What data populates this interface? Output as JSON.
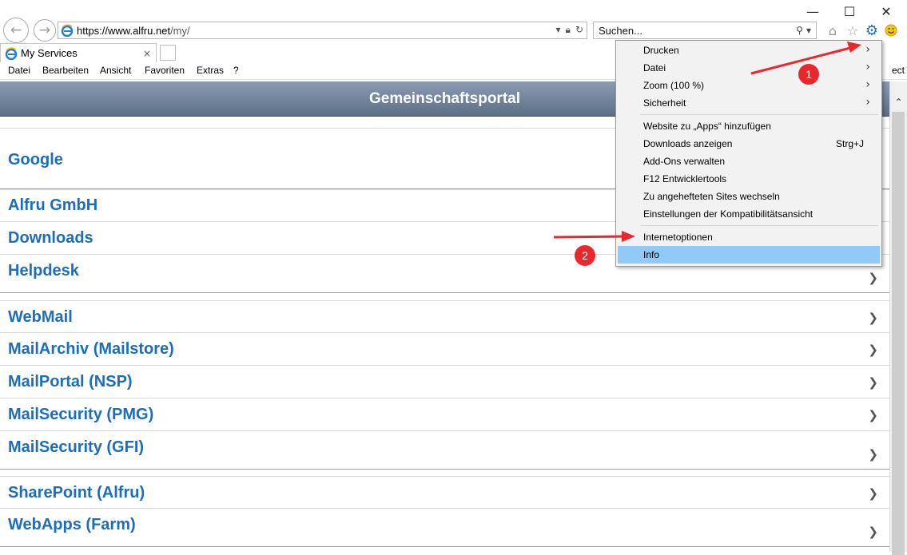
{
  "browser": {
    "address": {
      "host": "https://www.alfru.net",
      "path": "/my/"
    },
    "search_placeholder": "Suchen...",
    "tab_title": "My Services",
    "tab_close": "×",
    "menubar": [
      "Datei",
      "Bearbeiten",
      "Ansicht",
      "Favoriten",
      "Extras",
      "?"
    ],
    "menubar_right": "ect",
    "window_controls": [
      "minimize-icon",
      "maximize-icon",
      "close-icon"
    ],
    "toolbar_icons": [
      "home-icon",
      "star-icon",
      "gear-icon",
      "smiley-icon"
    ]
  },
  "page": {
    "title": "Gemeinschaftsportal",
    "groups": [
      [
        "Google"
      ],
      [
        "Alfru GmbH",
        "Downloads",
        "Helpdesk"
      ],
      [
        "WebMail",
        "MailArchiv (Mailstore)",
        "MailPortal (NSP)",
        "MailSecurity (PMG)",
        "MailSecurity (GFI)"
      ],
      [
        "SharePoint (Alfru)",
        "WebApps (Farm)"
      ]
    ]
  },
  "tools_menu": {
    "items": [
      {
        "label": "Drucken",
        "submenu": true
      },
      {
        "label": "Datei",
        "submenu": true
      },
      {
        "label": "Zoom (100 %)",
        "submenu": true
      },
      {
        "label": "Sicherheit",
        "submenu": true
      },
      {
        "label": "Website zu „Apps“ hinzufügen"
      },
      {
        "label": "Downloads anzeigen",
        "shortcut": "Strg+J"
      },
      {
        "label": "Add-Ons verwalten"
      },
      {
        "label": "F12 Entwicklertools"
      },
      {
        "label": "Zu angehefteten Sites wechseln"
      },
      {
        "label": "Einstellungen der Kompatibilitätsansicht"
      },
      {
        "label": "Internetoptionen"
      },
      {
        "label": "Info",
        "highlighted": true
      }
    ]
  },
  "annotations": {
    "badge1": "1",
    "badge2": "2",
    "color": "#e8282c"
  },
  "colors": {
    "link": "#1b6dbf",
    "menu_highlight": "#91c9f7"
  }
}
